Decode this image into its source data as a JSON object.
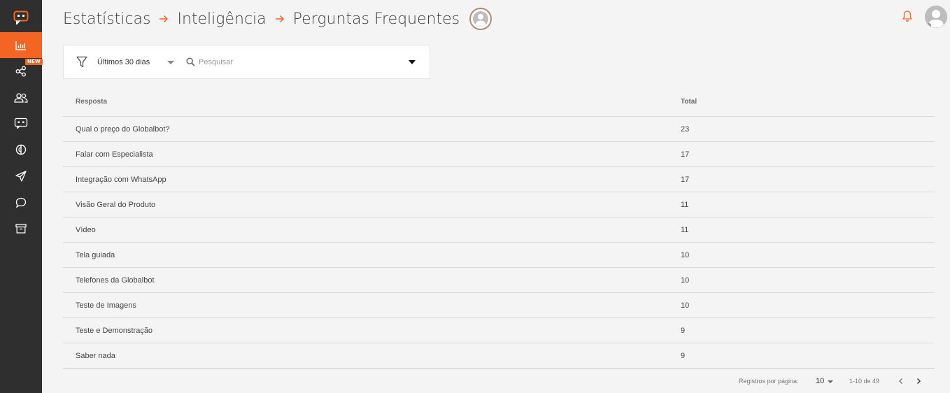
{
  "breadcrumb": [
    "Estatísticas",
    "Inteligência",
    "Perguntas Frequentes"
  ],
  "sidebar": {
    "items": [
      {
        "name": "statistics",
        "icon": "bar-chart-icon",
        "active": true
      },
      {
        "name": "integrations",
        "icon": "share-icon",
        "badge": "NEW"
      },
      {
        "name": "users",
        "icon": "users-icon"
      },
      {
        "name": "bots",
        "icon": "bot-icon"
      },
      {
        "name": "intelligence",
        "icon": "brain-icon"
      },
      {
        "name": "campaigns",
        "icon": "send-icon"
      },
      {
        "name": "conversations",
        "icon": "chat-icon"
      },
      {
        "name": "archive",
        "icon": "archive-icon"
      }
    ]
  },
  "filter": {
    "period": "Últimos 30 dias",
    "search_placeholder": "Pesquisar"
  },
  "table": {
    "headers": {
      "answer": "Resposta",
      "total": "Total"
    },
    "rows": [
      {
        "answer": "Qual o preço do Globalbot?",
        "total": "23"
      },
      {
        "answer": "Falar com Especialista",
        "total": "17"
      },
      {
        "answer": "Integração com WhatsApp",
        "total": "17"
      },
      {
        "answer": "Visão Geral do Produto",
        "total": "11"
      },
      {
        "answer": "Vídeo",
        "total": "11"
      },
      {
        "answer": "Tela guiada",
        "total": "10"
      },
      {
        "answer": "Telefones da Globalbot",
        "total": "10"
      },
      {
        "answer": "Teste de Imagens",
        "total": "10"
      },
      {
        "answer": "Teste e Demonstração",
        "total": "9"
      },
      {
        "answer": "Saber nada",
        "total": "9"
      }
    ]
  },
  "pagination": {
    "label": "Registros por página:",
    "page_size": "10",
    "range": "1-10 de 49"
  },
  "colors": {
    "accent": "#f46524",
    "sidebar": "#2f2f2f",
    "background": "#f4f4f4"
  }
}
